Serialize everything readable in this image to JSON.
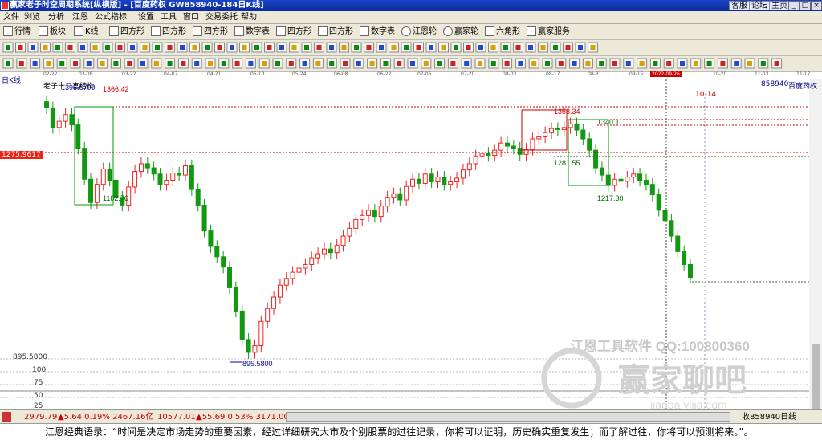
{
  "window": {
    "title": "赢家老子时空周期系统[纵横版] - [百度药权  GW858940-184日K线]",
    "top_links": [
      "客服",
      "论坛",
      "主页"
    ],
    "buttons": [
      "_",
      "□",
      "×"
    ]
  },
  "menu": [
    "文件",
    "浏览",
    "分析",
    "江恩",
    "公式指标",
    "设置",
    "工具",
    "窗口",
    "交易委托",
    "帮助"
  ],
  "toolbar1": [
    {
      "label": "行情",
      "icon": "grid-icon"
    },
    {
      "label": "板块",
      "icon": "blocks-icon"
    },
    {
      "label": "K线",
      "icon": "candle-icon"
    },
    {
      "label": "四方形",
      "icon": "square-icon"
    },
    {
      "label": "四方形",
      "icon": "square-icon"
    },
    {
      "label": "四方形",
      "icon": "square-icon"
    },
    {
      "label": "数字表",
      "icon": "table-icon"
    },
    {
      "label": "四方形",
      "icon": "square-icon"
    },
    {
      "label": "四方形",
      "icon": "square-icon"
    },
    {
      "label": "数字表",
      "icon": "table-icon"
    },
    {
      "label": "江恩轮",
      "icon": "wheel-icon"
    },
    {
      "label": "赢家轮",
      "icon": "wheel-icon"
    },
    {
      "label": "六角形",
      "icon": "hexagon-icon"
    },
    {
      "label": "赢家服务",
      "icon": "service-icon"
    }
  ],
  "dates": [
    "02-22",
    "03-08",
    "03-22",
    "04-07",
    "04-21",
    "05-10",
    "05-24",
    "06-08",
    "06-22",
    "07-06",
    "07-20",
    "08-03",
    "08-17",
    "08-31",
    "09-15",
    "2022-09-26",
    "10-20",
    "11-03",
    "11-17"
  ],
  "chart_header": {
    "period": "日K线",
    "indicator": "老子十二宫结构",
    "code": "858940",
    "name": "百度药权",
    "left_price_label": "1275.9617",
    "future_date": "10-14"
  },
  "chart_data": {
    "type": "candlestick",
    "annotations": [
      {
        "text": "1395.6700",
        "value": 1395.67
      },
      {
        "text": "1366.42",
        "value": 1366.42
      },
      {
        "text": "1182.76",
        "value": 1182.76
      },
      {
        "text": "1358.34",
        "value": 1358.34
      },
      {
        "text": "1340.11",
        "value": 1340.11
      },
      {
        "text": "1281.55",
        "value": 1281.55
      },
      {
        "text": "1217.30",
        "value": 1217.3
      },
      {
        "text": "895.5800",
        "value": 895.58
      }
    ],
    "left_axis_low": "895.5800",
    "indicator_ticks": [
      "100",
      "75",
      "50",
      "25"
    ],
    "closes": [
      1378,
      1340,
      1352,
      1365,
      1345,
      1300,
      1240,
      1195,
      1230,
      1260,
      1238,
      1205,
      1190,
      1225,
      1255,
      1270,
      1262,
      1250,
      1230,
      1238,
      1252,
      1248,
      1266,
      1220,
      1190,
      1140,
      1110,
      1090,
      1070,
      1030,
      985,
      930,
      905,
      918,
      965,
      990,
      1012,
      1035,
      1048,
      1060,
      1068,
      1075,
      1088,
      1096,
      1105,
      1098,
      1112,
      1130,
      1145,
      1162,
      1170,
      1180,
      1168,
      1188,
      1205,
      1212,
      1200,
      1226,
      1240,
      1232,
      1250,
      1235,
      1244,
      1230,
      1235,
      1242,
      1258,
      1270,
      1285,
      1290,
      1286,
      1296,
      1310,
      1304,
      1300,
      1288,
      1298,
      1318,
      1322,
      1330,
      1338,
      1336,
      1340,
      1347,
      1335,
      1318,
      1296,
      1262,
      1248,
      1228,
      1240,
      1236,
      1244,
      1250,
      1238,
      1230,
      1210,
      1180,
      1160,
      1130,
      1100,
      1075,
      1050
    ],
    "opens": [
      1390,
      1378,
      1340,
      1352,
      1365,
      1345,
      1300,
      1240,
      1195,
      1230,
      1260,
      1238,
      1205,
      1190,
      1225,
      1255,
      1270,
      1262,
      1250,
      1230,
      1238,
      1252,
      1248,
      1266,
      1220,
      1190,
      1140,
      1110,
      1090,
      1070,
      1030,
      985,
      930,
      905,
      918,
      965,
      990,
      1012,
      1035,
      1048,
      1060,
      1068,
      1075,
      1088,
      1096,
      1105,
      1098,
      1112,
      1130,
      1145,
      1162,
      1170,
      1180,
      1168,
      1188,
      1205,
      1212,
      1200,
      1226,
      1240,
      1232,
      1250,
      1235,
      1244,
      1230,
      1235,
      1242,
      1258,
      1270,
      1285,
      1290,
      1286,
      1296,
      1310,
      1304,
      1300,
      1288,
      1298,
      1318,
      1322,
      1330,
      1338,
      1336,
      1340,
      1347,
      1335,
      1318,
      1296,
      1262,
      1248,
      1228,
      1240,
      1236,
      1244,
      1250,
      1238,
      1230,
      1210,
      1180,
      1160,
      1130,
      1100,
      1075
    ]
  },
  "watermark": {
    "line1": "江恩工具软件  QQ:100800360",
    "line2": "赢家聊吧",
    "line3": "jiaoba.yijia.com"
  },
  "bottom": {
    "index1": "2979.79",
    "index1_change": "▲5.64 0.19% 2467.16亿",
    "index2": "10577.01",
    "index2_change": "▲55.69 0.53% 3171.00亿",
    "right_status": "收858940日线"
  },
  "status": {
    "quote": "江恩经典语录：“时间是决定市场走势的重要因素，经过详细研究大市及个别股票的过往记录，你将可以证明，历史确实重复发生；而了解过往，你将可以预测将来。”。"
  },
  "colors": {
    "up": "#ee2222",
    "down": "#119911",
    "title_bar": "#1a44c8",
    "box": "#009900"
  }
}
